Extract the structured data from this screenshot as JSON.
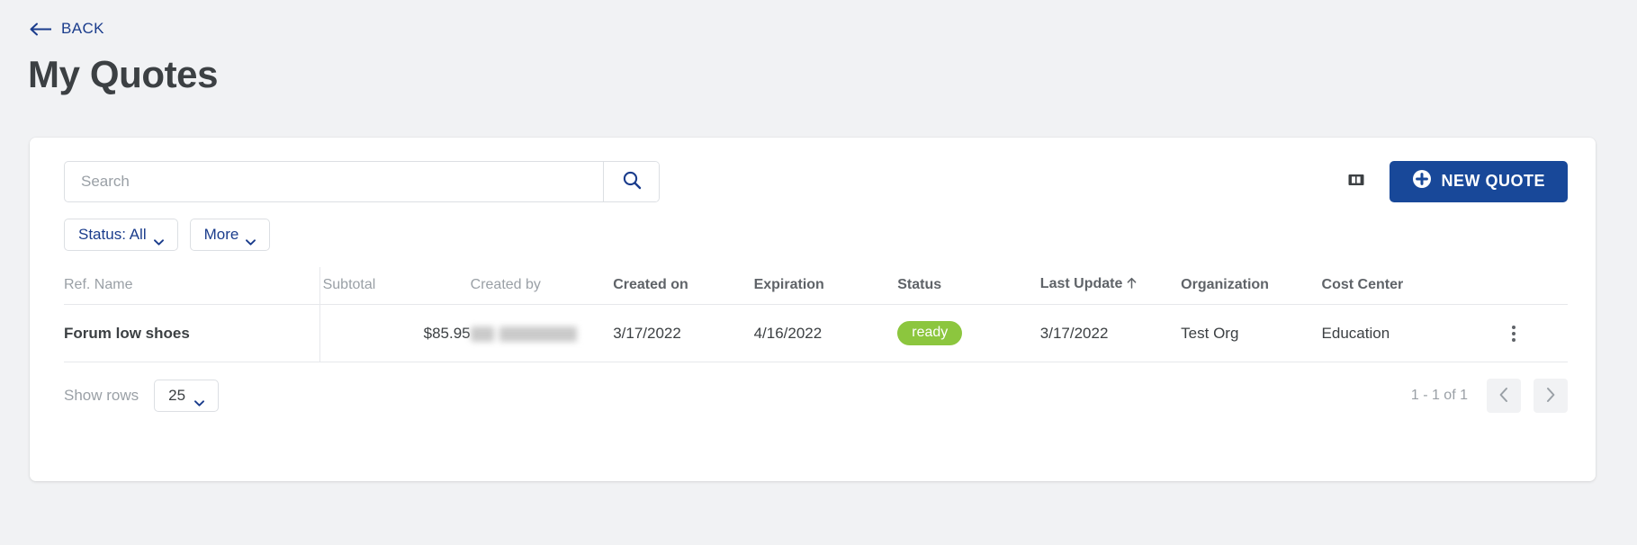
{
  "header": {
    "back_label": "BACK",
    "back_icon": "arrow-left-icon",
    "title": "My Quotes"
  },
  "toolbar": {
    "search_placeholder": "Search",
    "search_value": "",
    "search_button_icon": "search-icon",
    "columns_button_icon": "columns-layout-icon",
    "new_quote_label": "NEW QUOTE",
    "new_quote_icon": "plus-circle-icon"
  },
  "filters": [
    {
      "label": "Status: All",
      "icon": "chevron-down-icon"
    },
    {
      "label": "More",
      "icon": "chevron-down-icon"
    }
  ],
  "table": {
    "columns": [
      {
        "key": "ref_name",
        "label": "Ref. Name",
        "emphasis": "muted",
        "align": "left"
      },
      {
        "key": "subtotal",
        "label": "Subtotal",
        "emphasis": "muted",
        "align": "right"
      },
      {
        "key": "created_by",
        "label": "Created by",
        "emphasis": "muted",
        "align": "left"
      },
      {
        "key": "created_on",
        "label": "Created on",
        "emphasis": "strong",
        "align": "left"
      },
      {
        "key": "expiration",
        "label": "Expiration",
        "emphasis": "strong",
        "align": "left"
      },
      {
        "key": "status",
        "label": "Status",
        "emphasis": "strong",
        "align": "left"
      },
      {
        "key": "last_update",
        "label": "Last Update",
        "emphasis": "strong",
        "align": "left",
        "sort": "asc",
        "sort_icon": "arrow-up-icon"
      },
      {
        "key": "organization",
        "label": "Organization",
        "emphasis": "strong",
        "align": "left"
      },
      {
        "key": "cost_center",
        "label": "Cost Center",
        "emphasis": "strong",
        "align": "left"
      }
    ],
    "rows": [
      {
        "ref_name": "Forum low shoes",
        "subtotal": "$85.95",
        "created_by": "",
        "created_by_redacted": true,
        "created_on": "3/17/2022",
        "expiration": "4/16/2022",
        "status": "ready",
        "status_color": "#8cc63e",
        "last_update": "3/17/2022",
        "organization": "Test Org",
        "cost_center": "Education",
        "row_menu_icon": "kebab-menu-icon"
      }
    ]
  },
  "footer": {
    "show_rows_label": "Show rows",
    "rows_per_page": "25",
    "rows_per_page_icon": "chevron-down-icon",
    "range_label": "1 - 1 of 1",
    "prev_icon": "chevron-left-icon",
    "next_icon": "chevron-right-icon"
  },
  "colors": {
    "page_bg": "#f1f2f4",
    "card_bg": "#ffffff",
    "accent_blue": "#184899",
    "link_blue": "#1a3c8c",
    "status_green": "#8cc63e",
    "text_dark": "#3c4043",
    "text_muted": "#9aa0a6"
  }
}
